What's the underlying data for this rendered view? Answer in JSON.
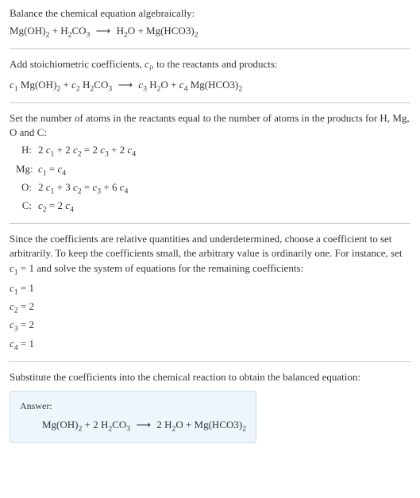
{
  "step1": {
    "text": "Balance the chemical equation algebraically:",
    "equation": "Mg(OH)₂ + H₂CO₃  ⟶  H₂O + Mg(HCO3)₂"
  },
  "step2": {
    "text": "Add stoichiometric coefficients, cᵢ, to the reactants and products:",
    "equation": "c₁ Mg(OH)₂ + c₂ H₂CO₃  ⟶  c₃ H₂O + c₄ Mg(HCO3)₂"
  },
  "step3": {
    "text": "Set the number of atoms in the reactants equal to the number of atoms in the products for H, Mg, O and C:",
    "rows": [
      {
        "label": "H:",
        "eq": "2 c₁ + 2 c₂ = 2 c₃ + 2 c₄"
      },
      {
        "label": "Mg:",
        "eq": "c₁ = c₄"
      },
      {
        "label": "O:",
        "eq": "2 c₁ + 3 c₂ = c₃ + 6 c₄"
      },
      {
        "label": "C:",
        "eq": "c₂ = 2 c₄"
      }
    ]
  },
  "step4": {
    "text": "Since the coefficients are relative quantities and underdetermined, choose a coefficient to set arbitrarily. To keep the coefficients small, the arbitrary value is ordinarily one. For instance, set c₁ = 1 and solve the system of equations for the remaining coefficients:",
    "coefs": [
      "c₁ = 1",
      "c₂ = 2",
      "c₃ = 2",
      "c₄ = 1"
    ]
  },
  "step5": {
    "text": "Substitute the coefficients into the chemical reaction to obtain the balanced equation:"
  },
  "answer": {
    "label": "Answer:",
    "equation": "Mg(OH)₂ + 2 H₂CO₃  ⟶  2 H₂O + Mg(HCO3)₂"
  }
}
